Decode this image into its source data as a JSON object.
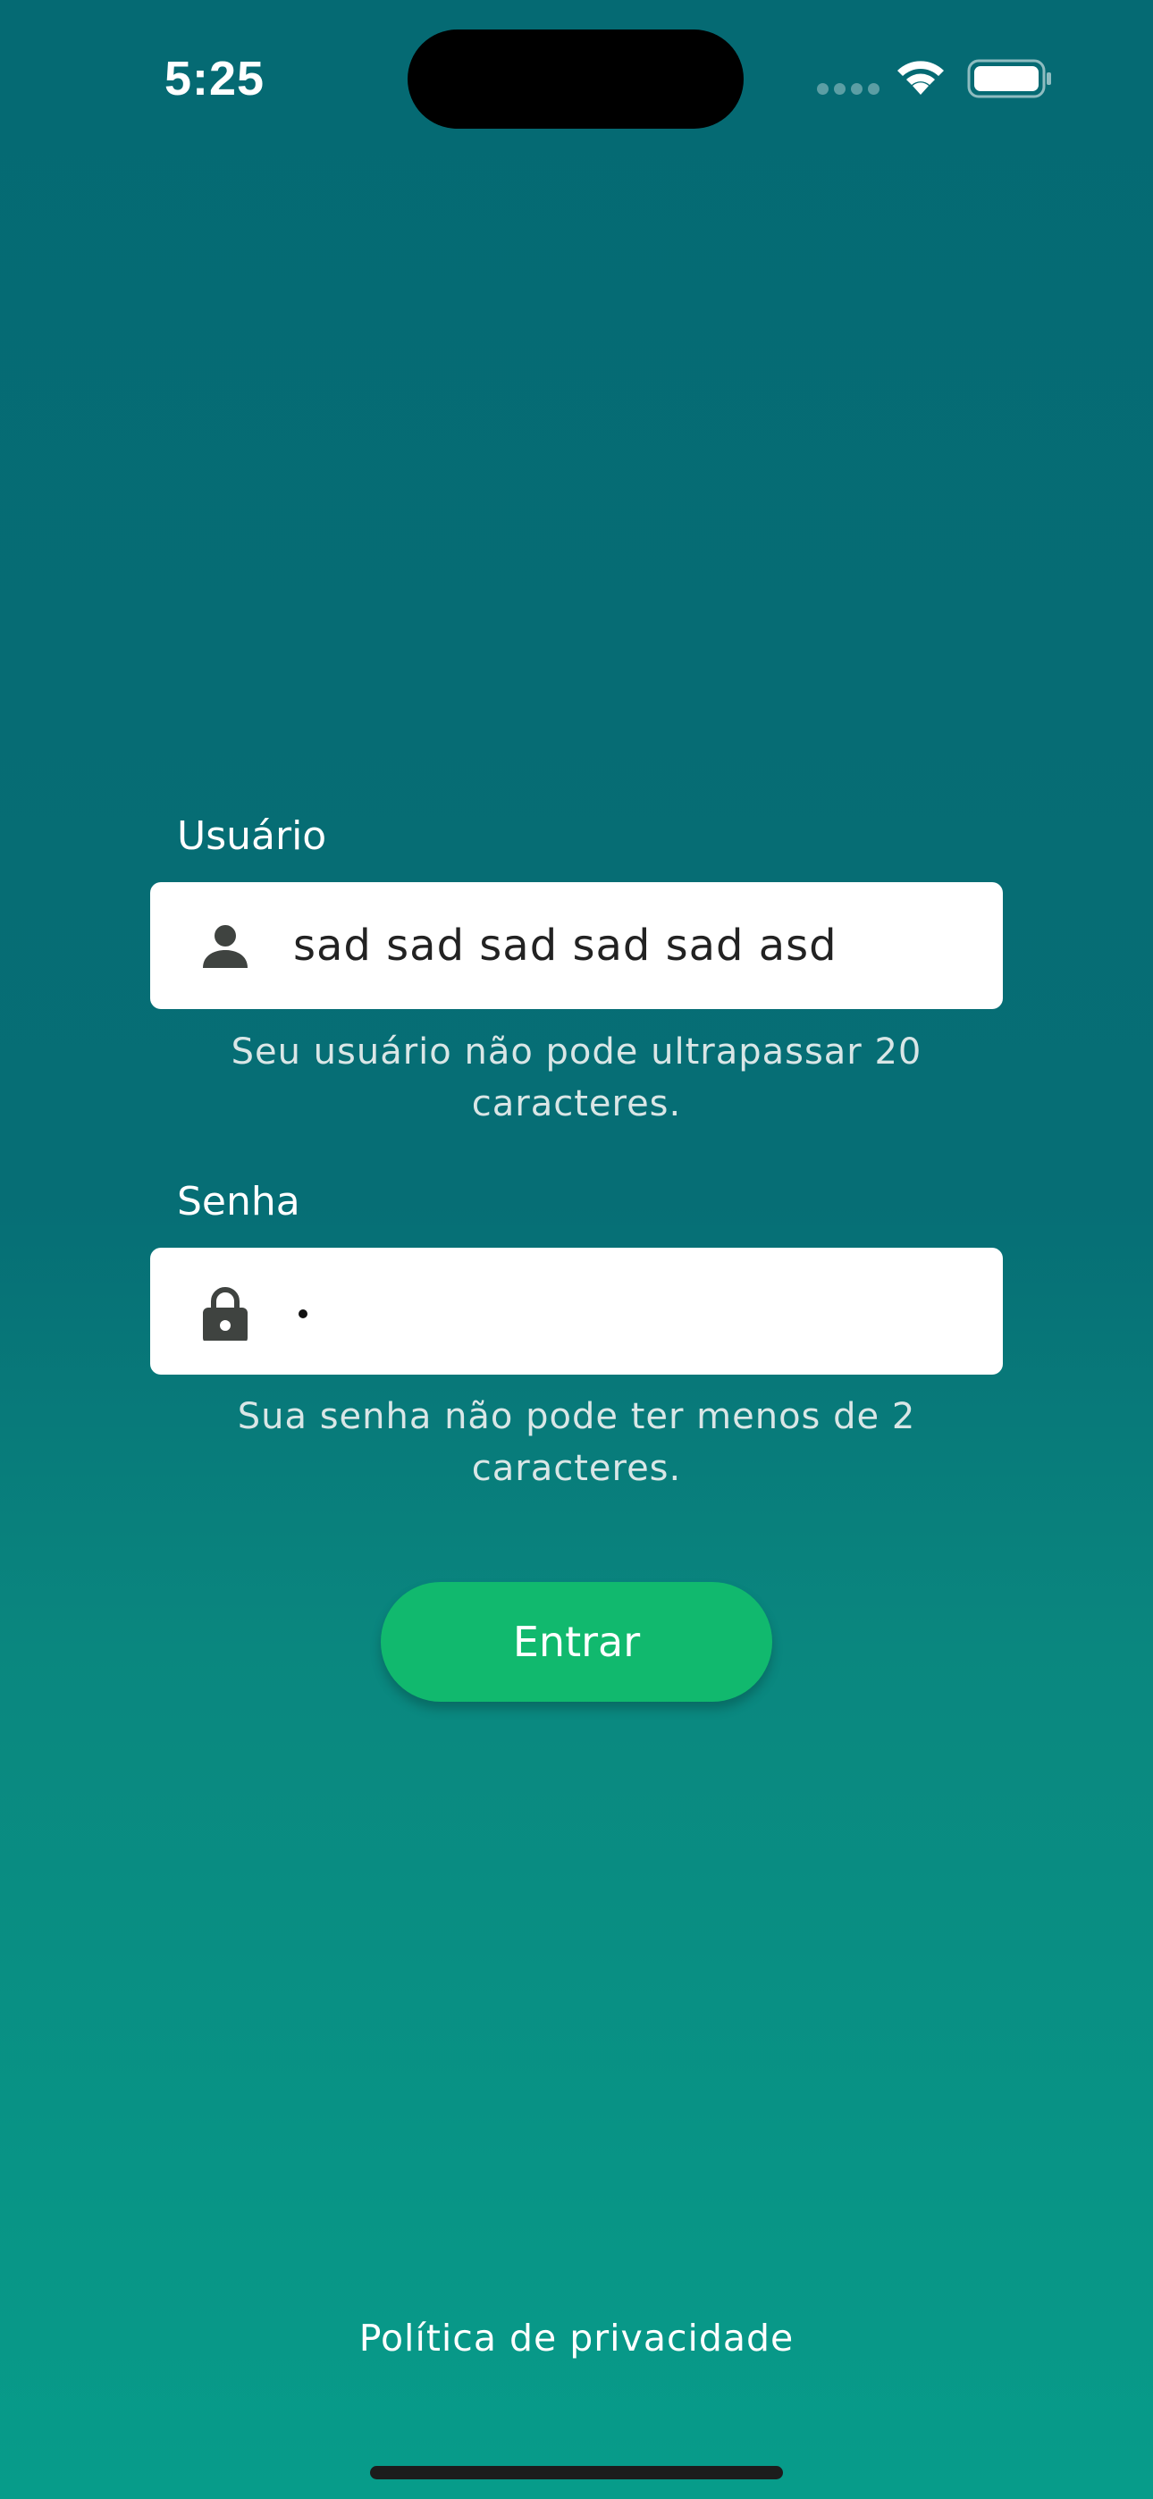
{
  "status_bar": {
    "time": "5:25"
  },
  "form": {
    "username": {
      "label": "Usuário",
      "value": "sad sad sad sad sad asd",
      "icon": "person-icon",
      "error": "Seu usuário não pode ultrapassar 20 caracteres."
    },
    "password": {
      "label": "Senha",
      "masked_length": 1,
      "icon": "lock-icon",
      "error": "Sua senha não pode ter menos de 2 caracteres."
    },
    "submit_label": "Entrar"
  },
  "footer": {
    "privacy_link": "Política de privacidade"
  },
  "colors": {
    "background_top": "#056a73",
    "background_bottom": "#079c8a",
    "button": "#11b96e",
    "icon": "#3f4340"
  }
}
